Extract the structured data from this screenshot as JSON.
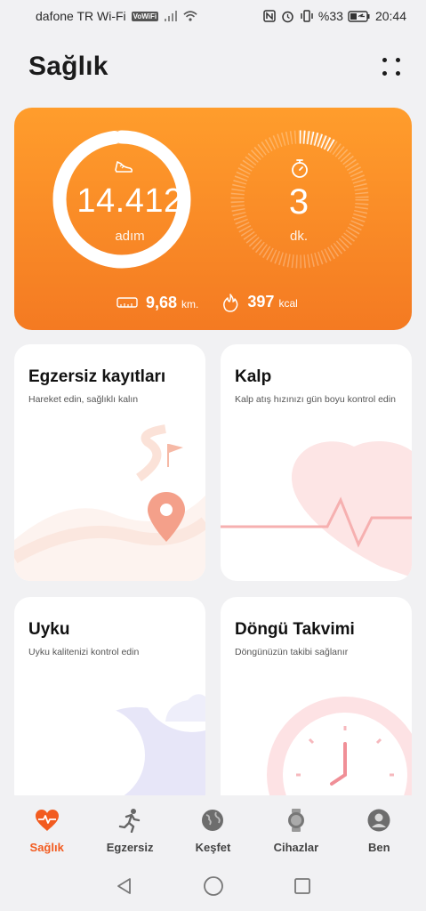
{
  "status_bar": {
    "carrier": "dafone TR Wi-Fi",
    "vowifi_badge": "VoWiFi",
    "battery_text": "%33",
    "time": "20:44",
    "icons": [
      "signal-icon",
      "wifi-icon",
      "nfc-icon",
      "alarm-icon",
      "vibrate-icon",
      "battery-icon"
    ]
  },
  "header": {
    "title": "Sağlık",
    "more_icon": "more-dots-icon"
  },
  "activity": {
    "steps_value": "14.412",
    "steps_unit": "adım",
    "steps_ring_progress": 0.98,
    "minutes_value": "3",
    "minutes_unit": "dk.",
    "minutes_ring_progress": 0.1,
    "distance_value": "9,68",
    "distance_unit": "km.",
    "calories_value": "397",
    "calories_unit": "kcal",
    "colors": {
      "gradient_top": "#ff9d2c",
      "gradient_bottom": "#f47a22"
    }
  },
  "tiles": {
    "exercise": {
      "title": "Egzersiz kayıtları",
      "subtitle": "Hareket edin, sağlıklı kalın"
    },
    "heart": {
      "title": "Kalp",
      "subtitle": "Kalp atış hızınızı gün boyu kontrol edin"
    },
    "sleep": {
      "title": "Uyku",
      "subtitle": "Uyku kalitenizi kontrol edin"
    },
    "cycle": {
      "title": "Döngü Takvimi",
      "subtitle": "Döngünüzün takibi sağlanır"
    }
  },
  "nav": {
    "items": [
      {
        "label": "Sağlık",
        "icon": "health-heart-icon",
        "active": true
      },
      {
        "label": "Egzersiz",
        "icon": "running-icon",
        "active": false
      },
      {
        "label": "Keşfet",
        "icon": "globe-icon",
        "active": false
      },
      {
        "label": "Cihazlar",
        "icon": "watch-icon",
        "active": false
      },
      {
        "label": "Ben",
        "icon": "profile-icon",
        "active": false
      }
    ],
    "active_color": "#f25b1f"
  },
  "system_nav": {
    "icons": [
      "back-icon",
      "home-icon",
      "recents-icon"
    ]
  }
}
